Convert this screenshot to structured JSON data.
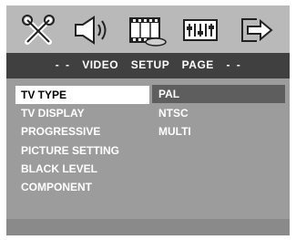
{
  "header": {
    "icons": [
      {
        "name": "settings-tools-icon"
      },
      {
        "name": "audio-speaker-icon"
      },
      {
        "name": "video-film-icon"
      },
      {
        "name": "preference-icon"
      },
      {
        "name": "exit-icon"
      }
    ]
  },
  "title": "- -  VIDEO  SETUP  PAGE  - -",
  "menu": {
    "left_items": [
      {
        "label": "TV TYPE",
        "selected": true
      },
      {
        "label": "TV DISPLAY"
      },
      {
        "label": "PROGRESSIVE"
      },
      {
        "label": "PICTURE SETTING"
      },
      {
        "label": "BLACK LEVEL"
      },
      {
        "label": "COMPONENT"
      }
    ],
    "right_items": [
      {
        "label": "PAL",
        "selected": true
      },
      {
        "label": "NTSC"
      },
      {
        "label": "MULTI"
      }
    ]
  },
  "colors": {
    "background": "#9c9c9c",
    "icon_bar": "#b9b9b9",
    "title_bar": "#404040",
    "selected_left": "#ffffff",
    "selected_right": "#5e5e5e",
    "text": "#ffffff"
  }
}
